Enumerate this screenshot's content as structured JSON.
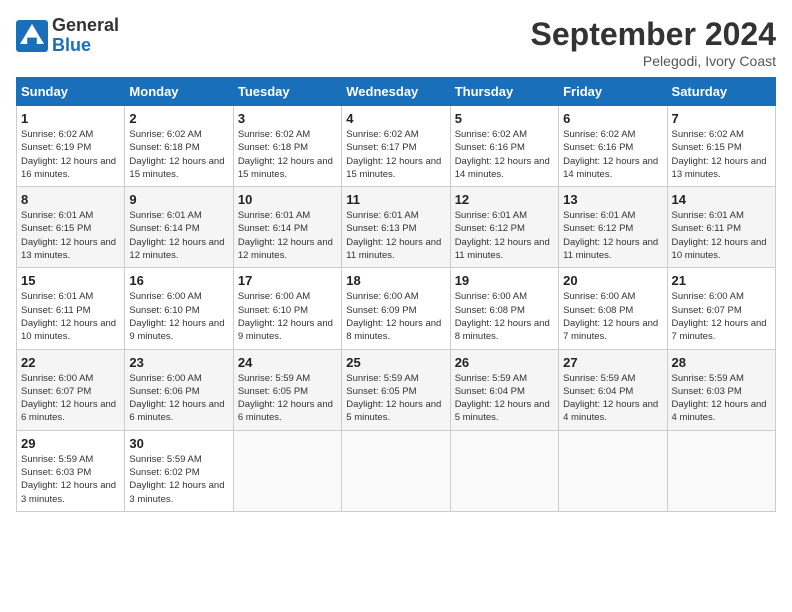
{
  "header": {
    "logo_text_general": "General",
    "logo_text_blue": "Blue",
    "month": "September 2024",
    "location": "Pelegodi, Ivory Coast"
  },
  "days_of_week": [
    "Sunday",
    "Monday",
    "Tuesday",
    "Wednesday",
    "Thursday",
    "Friday",
    "Saturday"
  ],
  "weeks": [
    [
      {
        "day": 1,
        "sunrise": "6:02 AM",
        "sunset": "6:19 PM",
        "daylight": "12 hours and 16 minutes."
      },
      {
        "day": 2,
        "sunrise": "6:02 AM",
        "sunset": "6:18 PM",
        "daylight": "12 hours and 15 minutes."
      },
      {
        "day": 3,
        "sunrise": "6:02 AM",
        "sunset": "6:18 PM",
        "daylight": "12 hours and 15 minutes."
      },
      {
        "day": 4,
        "sunrise": "6:02 AM",
        "sunset": "6:17 PM",
        "daylight": "12 hours and 15 minutes."
      },
      {
        "day": 5,
        "sunrise": "6:02 AM",
        "sunset": "6:16 PM",
        "daylight": "12 hours and 14 minutes."
      },
      {
        "day": 6,
        "sunrise": "6:02 AM",
        "sunset": "6:16 PM",
        "daylight": "12 hours and 14 minutes."
      },
      {
        "day": 7,
        "sunrise": "6:02 AM",
        "sunset": "6:15 PM",
        "daylight": "12 hours and 13 minutes."
      }
    ],
    [
      {
        "day": 8,
        "sunrise": "6:01 AM",
        "sunset": "6:15 PM",
        "daylight": "12 hours and 13 minutes."
      },
      {
        "day": 9,
        "sunrise": "6:01 AM",
        "sunset": "6:14 PM",
        "daylight": "12 hours and 12 minutes."
      },
      {
        "day": 10,
        "sunrise": "6:01 AM",
        "sunset": "6:14 PM",
        "daylight": "12 hours and 12 minutes."
      },
      {
        "day": 11,
        "sunrise": "6:01 AM",
        "sunset": "6:13 PM",
        "daylight": "12 hours and 11 minutes."
      },
      {
        "day": 12,
        "sunrise": "6:01 AM",
        "sunset": "6:12 PM",
        "daylight": "12 hours and 11 minutes."
      },
      {
        "day": 13,
        "sunrise": "6:01 AM",
        "sunset": "6:12 PM",
        "daylight": "12 hours and 11 minutes."
      },
      {
        "day": 14,
        "sunrise": "6:01 AM",
        "sunset": "6:11 PM",
        "daylight": "12 hours and 10 minutes."
      }
    ],
    [
      {
        "day": 15,
        "sunrise": "6:01 AM",
        "sunset": "6:11 PM",
        "daylight": "12 hours and 10 minutes."
      },
      {
        "day": 16,
        "sunrise": "6:00 AM",
        "sunset": "6:10 PM",
        "daylight": "12 hours and 9 minutes."
      },
      {
        "day": 17,
        "sunrise": "6:00 AM",
        "sunset": "6:10 PM",
        "daylight": "12 hours and 9 minutes."
      },
      {
        "day": 18,
        "sunrise": "6:00 AM",
        "sunset": "6:09 PM",
        "daylight": "12 hours and 8 minutes."
      },
      {
        "day": 19,
        "sunrise": "6:00 AM",
        "sunset": "6:08 PM",
        "daylight": "12 hours and 8 minutes."
      },
      {
        "day": 20,
        "sunrise": "6:00 AM",
        "sunset": "6:08 PM",
        "daylight": "12 hours and 7 minutes."
      },
      {
        "day": 21,
        "sunrise": "6:00 AM",
        "sunset": "6:07 PM",
        "daylight": "12 hours and 7 minutes."
      }
    ],
    [
      {
        "day": 22,
        "sunrise": "6:00 AM",
        "sunset": "6:07 PM",
        "daylight": "12 hours and 6 minutes."
      },
      {
        "day": 23,
        "sunrise": "6:00 AM",
        "sunset": "6:06 PM",
        "daylight": "12 hours and 6 minutes."
      },
      {
        "day": 24,
        "sunrise": "5:59 AM",
        "sunset": "6:05 PM",
        "daylight": "12 hours and 6 minutes."
      },
      {
        "day": 25,
        "sunrise": "5:59 AM",
        "sunset": "6:05 PM",
        "daylight": "12 hours and 5 minutes."
      },
      {
        "day": 26,
        "sunrise": "5:59 AM",
        "sunset": "6:04 PM",
        "daylight": "12 hours and 5 minutes."
      },
      {
        "day": 27,
        "sunrise": "5:59 AM",
        "sunset": "6:04 PM",
        "daylight": "12 hours and 4 minutes."
      },
      {
        "day": 28,
        "sunrise": "5:59 AM",
        "sunset": "6:03 PM",
        "daylight": "12 hours and 4 minutes."
      }
    ],
    [
      {
        "day": 29,
        "sunrise": "5:59 AM",
        "sunset": "6:03 PM",
        "daylight": "12 hours and 3 minutes."
      },
      {
        "day": 30,
        "sunrise": "5:59 AM",
        "sunset": "6:02 PM",
        "daylight": "12 hours and 3 minutes."
      },
      null,
      null,
      null,
      null,
      null
    ]
  ]
}
